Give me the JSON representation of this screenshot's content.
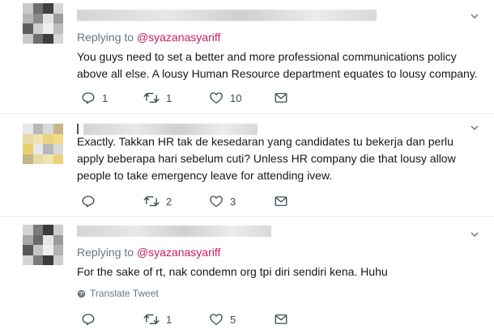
{
  "tweets": [
    {
      "replying_to_label": "Replying to",
      "replying_to_handle": "@syazanasyariff",
      "text": "You guys need to set a better and more professional communications policy above all else. A lousy Human Resource department equates to lousy company.",
      "reply_count": "1",
      "retweet_count": "1",
      "like_count": "10",
      "avatar_colors": [
        "#c9c9c9",
        "#6e6e6e",
        "#3f3f3f",
        "#d6d6d6",
        "#b5b5b5",
        "#8a8a8a",
        "#e3e3e3",
        "#9d9d9d",
        "#5d5d5d",
        "#cfcfcf",
        "#efefef",
        "#bdbdbd"
      ]
    },
    {
      "text": "Exactly. Takkan HR tak de kesedaran yang candidates tu bekerja dan perlu apply beberapa hari sebelum cuti? Unless HR company die that lousy allow people to take emergency leave for attending ivew.",
      "reply_count": "",
      "retweet_count": "2",
      "like_count": "3",
      "avatar_colors": [
        "#e7e7e7",
        "#b8b8b8",
        "#d9d9d9",
        "#c6b58a",
        "#e6d9a8",
        "#f0e3b0",
        "#ead27f",
        "#f2dc86",
        "#e9d06d"
      ]
    },
    {
      "replying_to_label": "Replying to",
      "replying_to_handle": "@syazanasyariff",
      "text": "For the sake of rt, nak condemn org tpi diri sendiri kena. Huhu",
      "translate_label": "Translate Tweet",
      "reply_count": "",
      "retweet_count": "1",
      "like_count": "5",
      "avatar_colors": [
        "#d3d3d3",
        "#7a7a7a",
        "#3b3b3b",
        "#cdcdcd",
        "#a8a8a8",
        "#6a6a6a",
        "#e6e6e6",
        "#9a9a9a",
        "#585858",
        "#c4c4c4",
        "#eeeeee",
        "#b2b2b2"
      ]
    }
  ],
  "icons": {
    "reply": "reply-icon",
    "retweet": "retweet-icon",
    "like": "heart-icon",
    "dm": "envelope-icon",
    "caret": "chevron-down-icon",
    "globe": "globe-icon"
  }
}
